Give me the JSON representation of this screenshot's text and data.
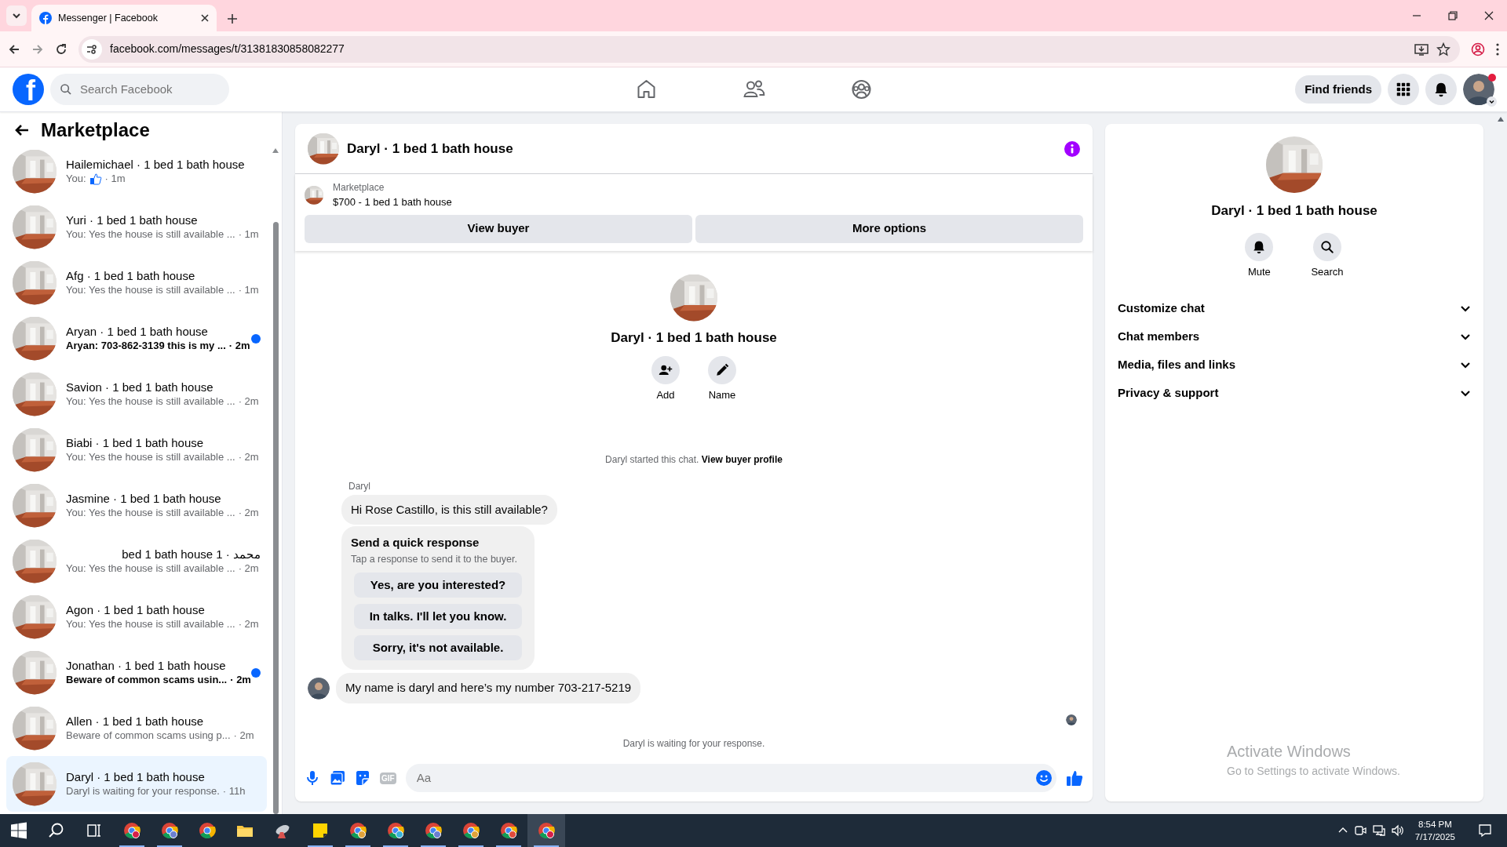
{
  "browser": {
    "tab_title": "Messenger | Facebook",
    "url": "facebook.com/messages/t/31381830858082277"
  },
  "header": {
    "logo": "f",
    "search_placeholder": "Search Facebook",
    "find_friends": "Find friends"
  },
  "sidebar": {
    "title": "Marketplace",
    "conversations": [
      {
        "name": "Hailemichael · 1 bed 1 bath house",
        "kind": "like",
        "preview": "You:",
        "time": "· 1m",
        "unread": false,
        "selected": false
      },
      {
        "name": "Yuri · 1 bed 1 bath house",
        "kind": "text",
        "preview": "You: Yes the house is still available ...",
        "time": "· 1m",
        "unread": false,
        "selected": false
      },
      {
        "name": "Afg · 1 bed 1 bath house",
        "kind": "text",
        "preview": "You: Yes the house is still available ...",
        "time": "· 1m",
        "unread": false,
        "selected": false
      },
      {
        "name": "Aryan · 1 bed 1 bath house",
        "kind": "text",
        "preview": "Aryan: 703-862-3139 this is my ...",
        "time": "· 2m",
        "unread": true,
        "selected": false
      },
      {
        "name": "Savion · 1 bed 1 bath house",
        "kind": "text",
        "preview": "You: Yes the house is still available ...",
        "time": "· 2m",
        "unread": false,
        "selected": false
      },
      {
        "name": "Biabi · 1 bed 1 bath house",
        "kind": "text",
        "preview": "You: Yes the house is still available ...",
        "time": "· 2m",
        "unread": false,
        "selected": false
      },
      {
        "name": "Jasmine · 1 bed 1 bath house",
        "kind": "text",
        "preview": "You: Yes the house is still available ...",
        "time": "· 2m",
        "unread": false,
        "selected": false
      },
      {
        "name": "محمد · 1 bed 1 bath house",
        "kind": "text",
        "preview": "You: Yes the house is still available ...",
        "time": "· 2m",
        "unread": false,
        "selected": false
      },
      {
        "name": "Agon · 1 bed 1 bath house",
        "kind": "text",
        "preview": "You: Yes the house is still available ...",
        "time": "· 2m",
        "unread": false,
        "selected": false
      },
      {
        "name": "Jonathan · 1 bed 1 bath house",
        "kind": "text",
        "preview": "Beware of common scams usin...",
        "time": "· 2m",
        "unread": true,
        "selected": false
      },
      {
        "name": "Allen · 1 bed 1 bath house",
        "kind": "text",
        "preview": "Beware of common scams using p...",
        "time": "· 2m",
        "unread": false,
        "selected": false
      },
      {
        "name": "Daryl · 1 bed 1 bath house",
        "kind": "text",
        "preview": "Daryl is waiting for your response.",
        "time": "· 11h",
        "unread": false,
        "selected": true
      }
    ]
  },
  "chat": {
    "title": "Daryl · 1 bed 1 bath house",
    "listing": {
      "label": "Marketplace",
      "title": "$700 - 1 bed 1 bath house"
    },
    "buttons": [
      "View buyer",
      "More options"
    ],
    "intro": {
      "name": "Daryl · 1 bed 1 bath house",
      "actions": [
        {
          "label": "Add",
          "kind": "add"
        },
        {
          "label": "Name",
          "kind": "edit"
        }
      ]
    },
    "start_note": "Daryl started this chat.",
    "start_link": "View buyer profile",
    "sender": "Daryl",
    "first_message": "Hi Rose Castillo, is this still available?",
    "quick_response": {
      "title": "Send a quick response",
      "subtitle": "Tap a response to send it to the buyer.",
      "options": [
        "Yes, are you interested?",
        "In talks. I'll let you know.",
        "Sorry, it's not available."
      ]
    },
    "last_message": "My name is daryl and here’s my number 703-217-5219",
    "waiting_note": "Daryl is waiting for your response.",
    "composer": {
      "gif": "GIF",
      "placeholder": "Aa"
    }
  },
  "details": {
    "name": "Daryl · 1 bed 1 bath house",
    "actions": [
      {
        "label": "Mute",
        "kind": "bell"
      },
      {
        "label": "Search",
        "kind": "search"
      }
    ],
    "sections": [
      {
        "label": "Customize chat",
        "expanded": false
      },
      {
        "label": "Chat members",
        "expanded": false
      },
      {
        "label": "Media, files and links",
        "expanded": false
      },
      {
        "label": "Privacy & support",
        "expanded": false
      }
    ]
  },
  "taskbar": {
    "time": "8:54 PM",
    "date": "7/17/2025"
  },
  "watermark": {
    "title": "Activate Windows",
    "subtitle": "Go to Settings to activate Windows."
  }
}
